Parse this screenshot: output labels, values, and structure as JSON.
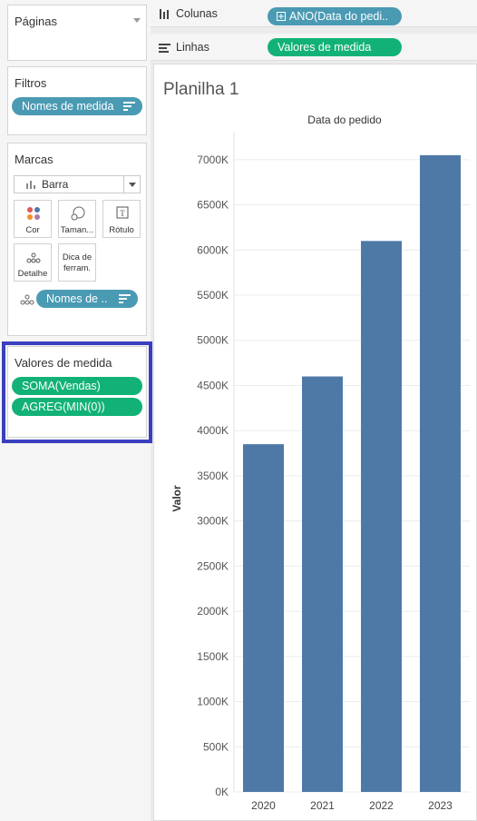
{
  "left_panel": {
    "paginas": {
      "title": "Páginas"
    },
    "filtros": {
      "title": "Filtros",
      "pill": "Nomes de medida"
    },
    "marcas": {
      "title": "Marcas",
      "mark_type": "Barra",
      "buttons": {
        "cor": "Cor",
        "tamanho": "Taman...",
        "rotulo": "Rótulo",
        "detalhe": "Detalhe",
        "dica_line1": "Dica de",
        "dica_line2": "ferram."
      },
      "detail_pill": "Nomes de .."
    },
    "valores_de_medida": {
      "title": "Valores de medida",
      "pills": [
        "SOMA(Vendas)",
        "AGREG(MIN(0))"
      ]
    }
  },
  "shelves": {
    "colunas": {
      "label": "Colunas",
      "pill": "ANO(Data do pedi.."
    },
    "linhas": {
      "label": "Linhas",
      "pill": "Valores de medida"
    }
  },
  "sheet": {
    "title": "Planilha 1"
  },
  "colors": {
    "bar": "#4e79a7",
    "pill_blue": "#4a9ab3",
    "pill_green": "#12b276",
    "highlight": "#3a3fc0"
  },
  "chart_data": {
    "type": "bar",
    "title": "Data do pedido",
    "xlabel": "",
    "ylabel": "Valor",
    "categories": [
      "2020",
      "2021",
      "2022",
      "2023"
    ],
    "values": [
      3850000,
      4600000,
      6100000,
      7050000
    ],
    "ylim": [
      0,
      7300000
    ],
    "yticks": [
      0,
      500000,
      1000000,
      1500000,
      2000000,
      2500000,
      3000000,
      3500000,
      4000000,
      4500000,
      5000000,
      5500000,
      6000000,
      6500000,
      7000000
    ],
    "ytick_labels": [
      "0K",
      "500K",
      "1000K",
      "1500K",
      "2000K",
      "2500K",
      "3000K",
      "3500K",
      "4000K",
      "4500K",
      "5000K",
      "5500K",
      "6000K",
      "6500K",
      "7000K"
    ],
    "grid": true,
    "legend": "none"
  }
}
